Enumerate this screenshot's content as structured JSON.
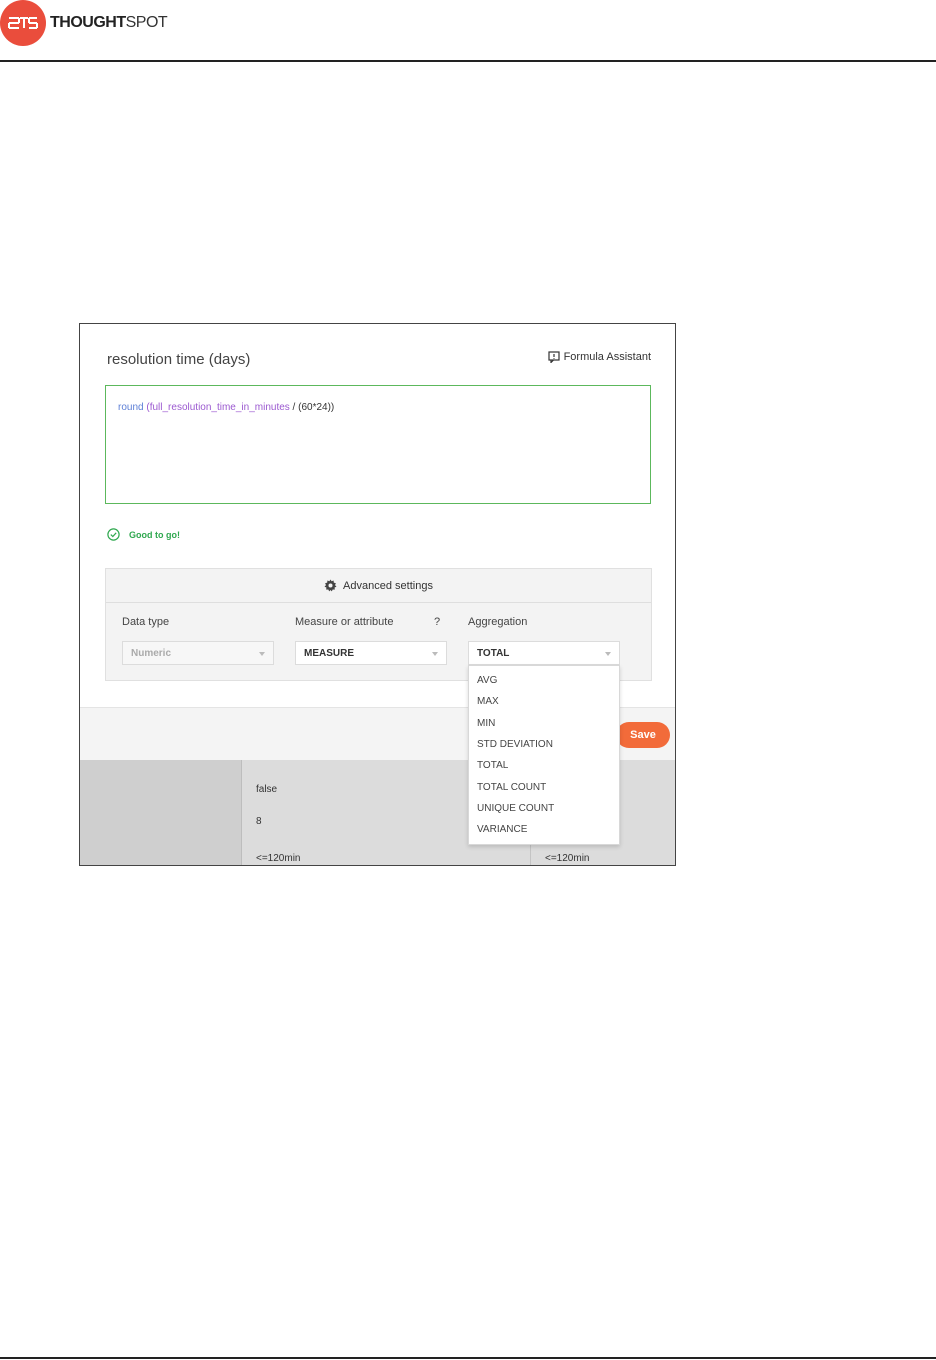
{
  "header": {
    "brand_bold": "THOUGHT",
    "brand_light": "SPOT"
  },
  "dialog": {
    "title": "resolution time (days)",
    "assistant_label": "Formula Assistant",
    "formula": {
      "fn": "round",
      "open": "(",
      "column": "full_resolution_time_in_minutes",
      "rest": " / (60*24))"
    },
    "status": "Good to go!",
    "advanced_label": "Advanced settings",
    "data_type": {
      "label": "Data type",
      "value": "Numeric"
    },
    "measure": {
      "label": "Measure or attribute",
      "help": "?",
      "value": "MEASURE"
    },
    "aggregation": {
      "label": "Aggregation",
      "value": "TOTAL",
      "options": [
        "AVG",
        "MAX",
        "MIN",
        "STD DEVIATION",
        "TOTAL",
        "TOTAL COUNT",
        "UNIQUE COUNT",
        "VARIANCE"
      ]
    },
    "save_label": "Save"
  },
  "background_table": {
    "rows": [
      {
        "b": "false",
        "c": ""
      },
      {
        "b": "8",
        "c": ""
      },
      {
        "b": "<=120min",
        "c": "<=120min"
      }
    ]
  },
  "colors": {
    "accent": "#ea4d3c",
    "valid": "#5cb85c",
    "save": "#f26b3a"
  }
}
